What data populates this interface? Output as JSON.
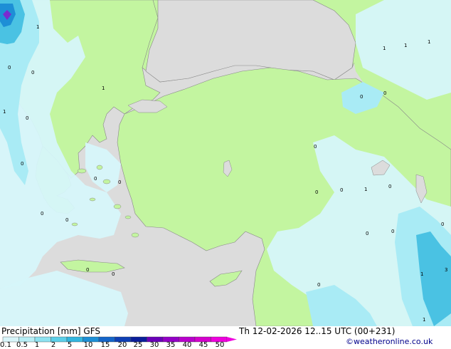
{
  "title": "Precipitation [mm]",
  "model": "GFS",
  "valid_time": "Th 12-02-2026 12..15 UTC (00+231)",
  "credit": "©weatheronline.co.uk",
  "legend": {
    "ticks": [
      "0.1",
      "0.5",
      "1",
      "2",
      "5",
      "10",
      "15",
      "20",
      "25",
      "30",
      "35",
      "40",
      "45",
      "50"
    ],
    "colors": [
      "#d8f5fa",
      "#b7eef6",
      "#8de2f0",
      "#5ccfe8",
      "#33b6df",
      "#1d8fd6",
      "#1565c8",
      "#0f3fb4",
      "#0a1e9a",
      "#6a00b8",
      "#9300c6",
      "#b800cc",
      "#d400cc",
      "#ee00dd"
    ]
  },
  "colors": {
    "land": "#c3f5a0",
    "sea": "#dcdcdc",
    "precip_light": "#d6f6fa",
    "precip_mid": "#a9ebf5",
    "precip_heavy": "#4ac2e3"
  },
  "map_values": [
    "1",
    "1",
    "1",
    "1",
    "0",
    "0",
    "1",
    "0",
    "0",
    "1",
    "0",
    "0",
    "0",
    "0",
    "0",
    "0",
    "0",
    "0",
    "0",
    "1",
    "0",
    "0",
    "0",
    "0",
    "0",
    "0",
    "0",
    "1",
    "3",
    "1"
  ]
}
